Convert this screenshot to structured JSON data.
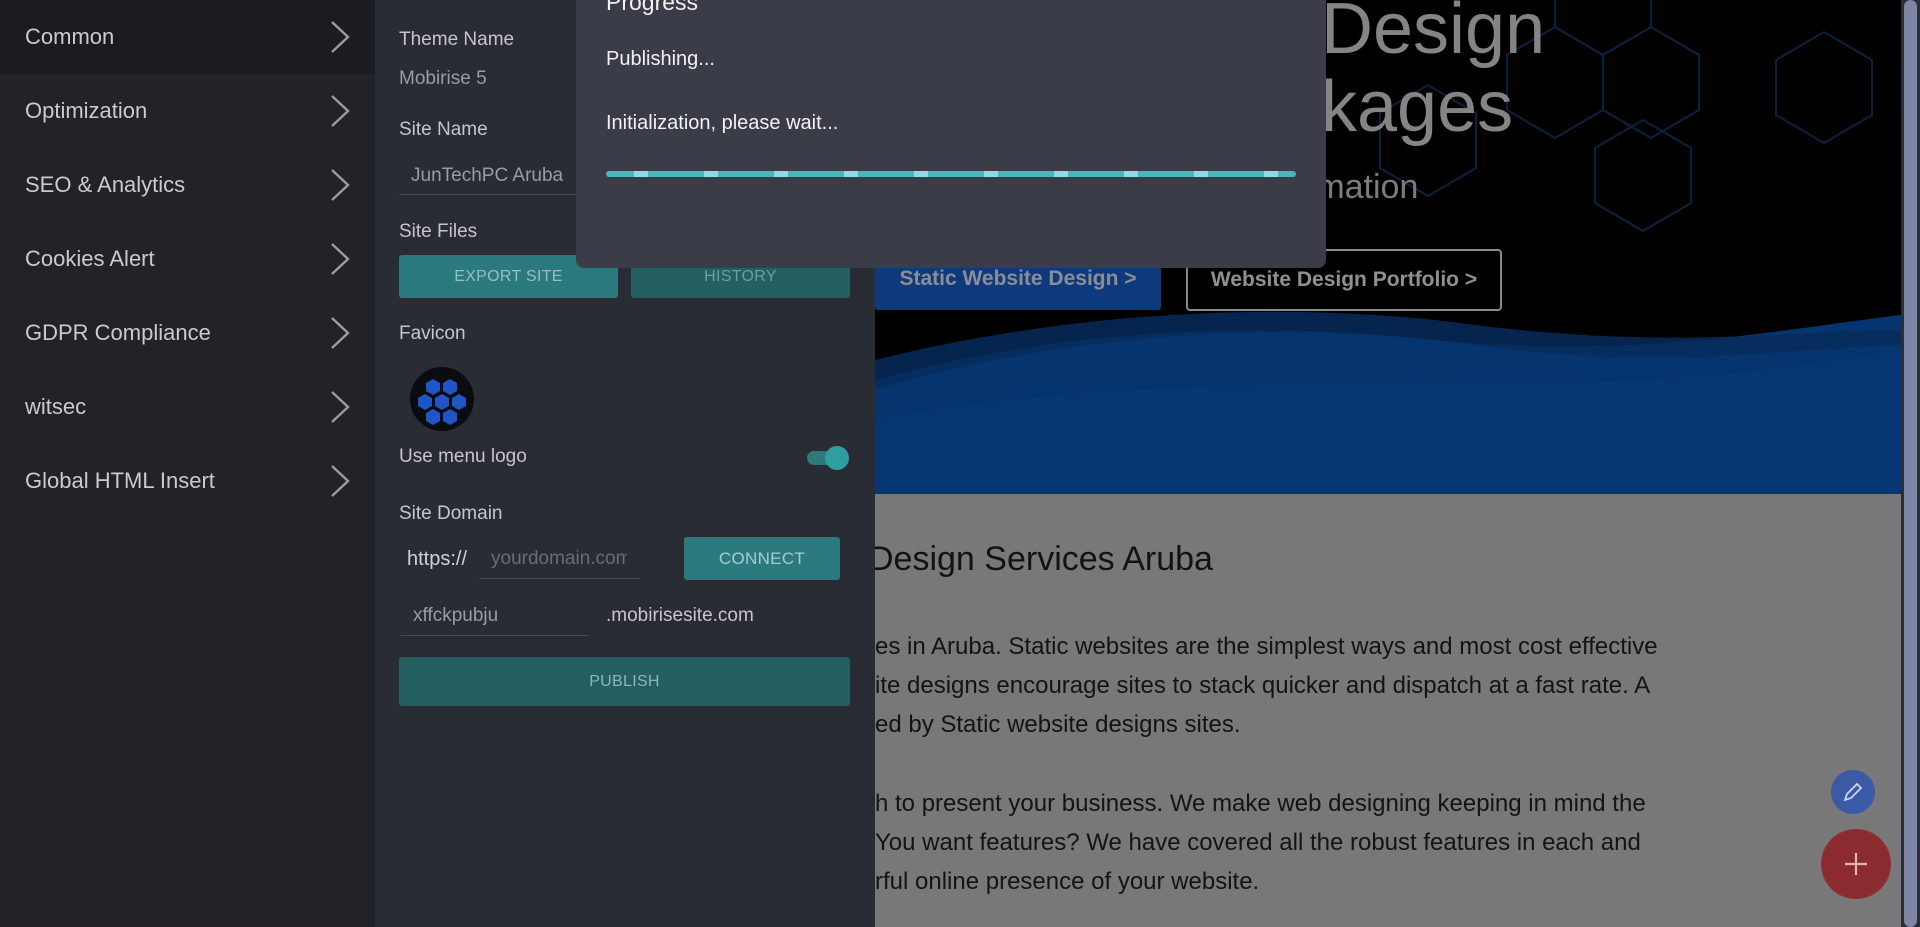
{
  "sidebar": {
    "items": [
      {
        "label": "Common"
      },
      {
        "label": "Optimization"
      },
      {
        "label": "SEO & Analytics"
      },
      {
        "label": "Cookies Alert"
      },
      {
        "label": "GDPR Compliance"
      },
      {
        "label": "witsec"
      },
      {
        "label": "Global HTML Insert"
      }
    ]
  },
  "panel": {
    "theme_name_label": "Theme Name",
    "theme_name_value": "Mobirise 5",
    "site_name_label": "Site Name",
    "site_name_value": "JunTechPC Aruba",
    "site_files_label": "Site Files",
    "export_button": "EXPORT SITE",
    "history_button": "HISTORY",
    "favicon_label": "Favicon",
    "use_menu_logo_label": "Use menu logo",
    "use_menu_logo_on": true,
    "site_domain_label": "Site Domain",
    "domain_prefix": "https://",
    "domain_placeholder": "yourdomain.com",
    "connect_button": "CONNECT",
    "subdomain_value": "xffckpubju",
    "subdomain_suffix": ".mobirisesite.com",
    "publish_button": "PUBLISH"
  },
  "modal": {
    "title": "Progress",
    "status": "Publishing...",
    "message": "Initialization, please wait...",
    "accent_color": "#46b7bd"
  },
  "site": {
    "hero_title_line1": "Design",
    "hero_title_line2": "kages",
    "hero_subtitle": "rmation",
    "button_primary": "Static Website Design >",
    "button_secondary": "Website Design Portfolio >",
    "section_heading": "Design Services Aruba",
    "paragraph1": [
      "es in Aruba. Static websites are the simplest ways and most cost effective",
      "ite designs encourage sites to stack quicker and dispatch at a fast rate. A",
      "ed by Static website designs sites."
    ],
    "paragraph2": [
      "h to present your business. We make web designing keeping in mind the",
      "You want features? We have covered all the robust features in each and",
      "rful online presence of your website."
    ],
    "brand_blue": "#0a57b8"
  },
  "fab": {
    "edit_icon": "pencil-icon",
    "add_icon": "plus-icon"
  }
}
